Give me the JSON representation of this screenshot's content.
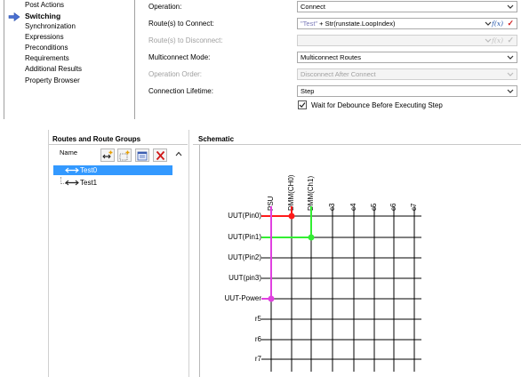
{
  "nav": {
    "items": [
      {
        "label": "Post Actions",
        "active": false
      },
      {
        "label": "Switching",
        "active": true
      },
      {
        "label": "Synchronization",
        "active": false
      },
      {
        "label": "Expressions",
        "active": false
      },
      {
        "label": "Preconditions",
        "active": false
      },
      {
        "label": "Requirements",
        "active": false
      },
      {
        "label": "Additional Results",
        "active": false
      },
      {
        "label": "Property Browser",
        "active": false
      }
    ]
  },
  "props": {
    "operation": {
      "label": "Operation:",
      "value": "Connect"
    },
    "routes_connect": {
      "label": "Route(s) to Connect:",
      "value_str": "\"Test\"",
      "value_rest": " + Str(runstate.LoopIndex)",
      "fx": "f(x)",
      "check": "✓"
    },
    "routes_disconnect": {
      "label": "Route(s) to Disconnect:",
      "value": "",
      "fx": "f(x)",
      "check": "✓"
    },
    "multiconnect": {
      "label": "Multiconnect Mode:",
      "value": "Multiconnect Routes"
    },
    "operation_order": {
      "label": "Operation Order:",
      "value": "Disconnect After Connect"
    },
    "lifetime": {
      "label": "Connection Lifetime:",
      "value": "Step"
    },
    "debounce": {
      "label": "Wait for Debounce Before Executing Step",
      "checked": true
    }
  },
  "routes": {
    "title": "Routes and Route Groups",
    "column": "Name",
    "items": [
      {
        "label": "Test0",
        "selected": true
      },
      {
        "label": "Test1",
        "selected": false
      }
    ]
  },
  "schematic": {
    "title": "Schematic",
    "columns": [
      "PSU",
      "DMM(CH0)",
      "DMM(Ch1)",
      "c3",
      "c4",
      "c5",
      "c6",
      "c7"
    ],
    "rows": [
      "UUT(Pin0)",
      "UUT(Pin1)",
      "UUT(Pin2)",
      "UUT(pin3)",
      "UUT-Power",
      "r5",
      "r6",
      "r7"
    ],
    "connections": [
      {
        "route": "Test0",
        "row": 0,
        "col": 1,
        "color": "#ff1a1a"
      },
      {
        "route": "Test1",
        "row": 1,
        "col": 2,
        "color": "#33ee33"
      },
      {
        "route": "Power",
        "row": 4,
        "col": 0,
        "color": "#e040e0"
      }
    ]
  }
}
